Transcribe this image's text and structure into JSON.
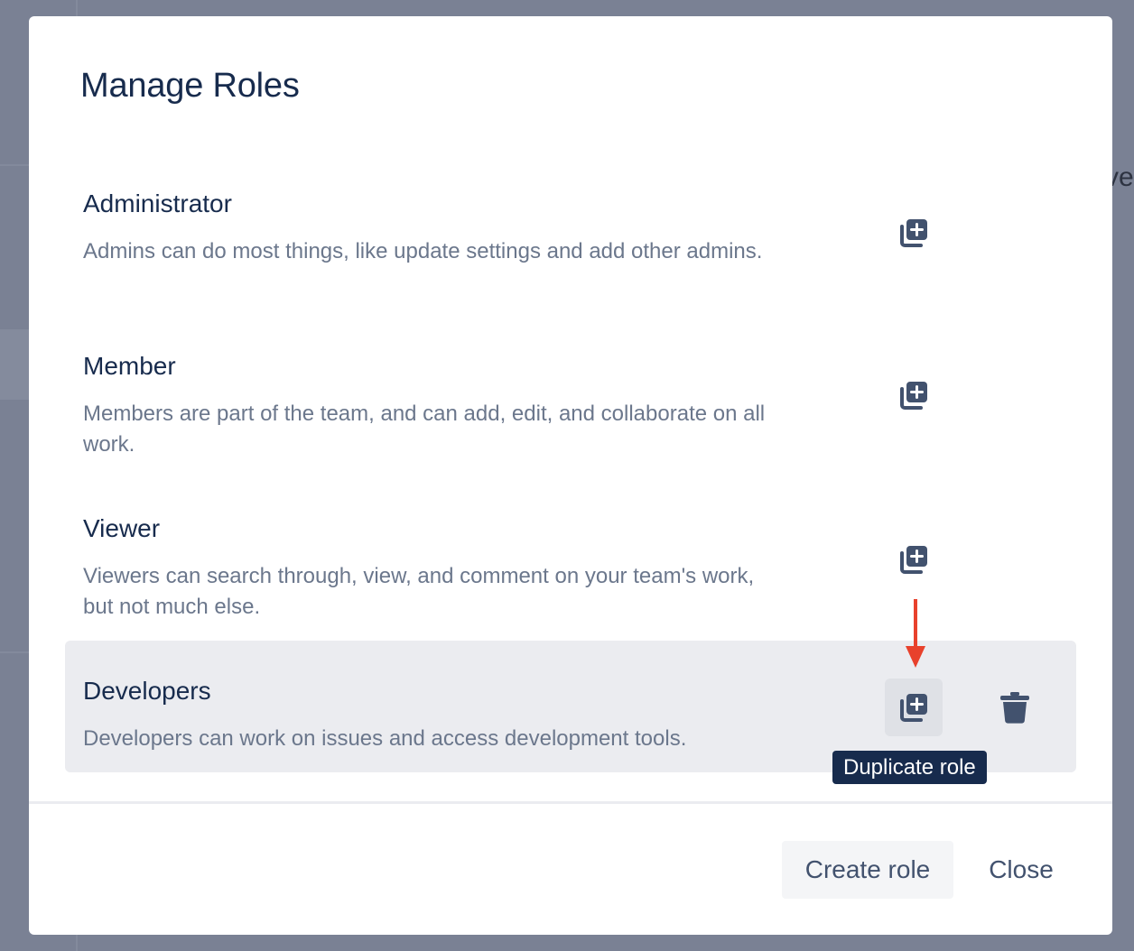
{
  "background": {
    "peek_text": "ve"
  },
  "modal": {
    "title": "Manage Roles",
    "roles": [
      {
        "name": "Administrator",
        "description": "Admins can do most things, like update settings and add other admins."
      },
      {
        "name": "Member",
        "description": "Members are part of the team, and can add, edit, and collaborate on all work."
      },
      {
        "name": "Viewer",
        "description": "Viewers can search through, view, and comment on your team's work, but not much else."
      },
      {
        "name": "Developers",
        "description": "Developers can work on issues and access development tools."
      }
    ],
    "tooltip": "Duplicate role",
    "footer": {
      "create_label": "Create role",
      "close_label": "Close"
    }
  },
  "icons": {
    "duplicate": "duplicate-icon",
    "delete": "trash-icon",
    "annotation": "arrow-down-icon"
  },
  "colors": {
    "title": "#172b4d",
    "description": "#6b778c",
    "icon": "#42526e",
    "active_row": "#ebecf0",
    "tooltip_bg": "#172b4d",
    "annotation_arrow": "#e8412c"
  }
}
